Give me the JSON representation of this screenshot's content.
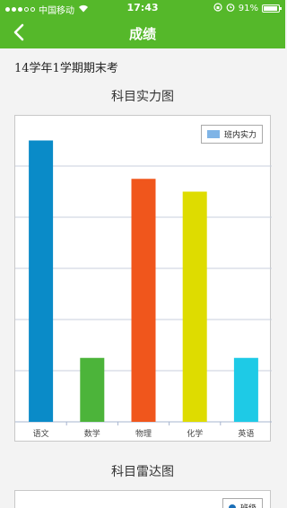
{
  "status": {
    "carrier": "中国移动",
    "time": "17:43",
    "battery": "91%",
    "battery_level": 0.91
  },
  "navbar": {
    "title": "成绩"
  },
  "exam": {
    "title": "14学年1学期期末考"
  },
  "chart1": {
    "title": "科目实力图",
    "legend": "班内实力"
  },
  "chart2": {
    "title": "科目雷达图",
    "legend": "班级"
  },
  "chart_data": {
    "type": "bar",
    "categories": [
      "语文",
      "数学",
      "物理",
      "化学",
      "英语"
    ],
    "values": [
      5.5,
      1.25,
      4.75,
      4.5,
      1.25
    ],
    "colors": [
      "#0a8bc8",
      "#4cb43a",
      "#f0561c",
      "#dedc00",
      "#1ecae6"
    ],
    "ylim": [
      0,
      6
    ],
    "grid": true,
    "legend_position": "top-right"
  }
}
